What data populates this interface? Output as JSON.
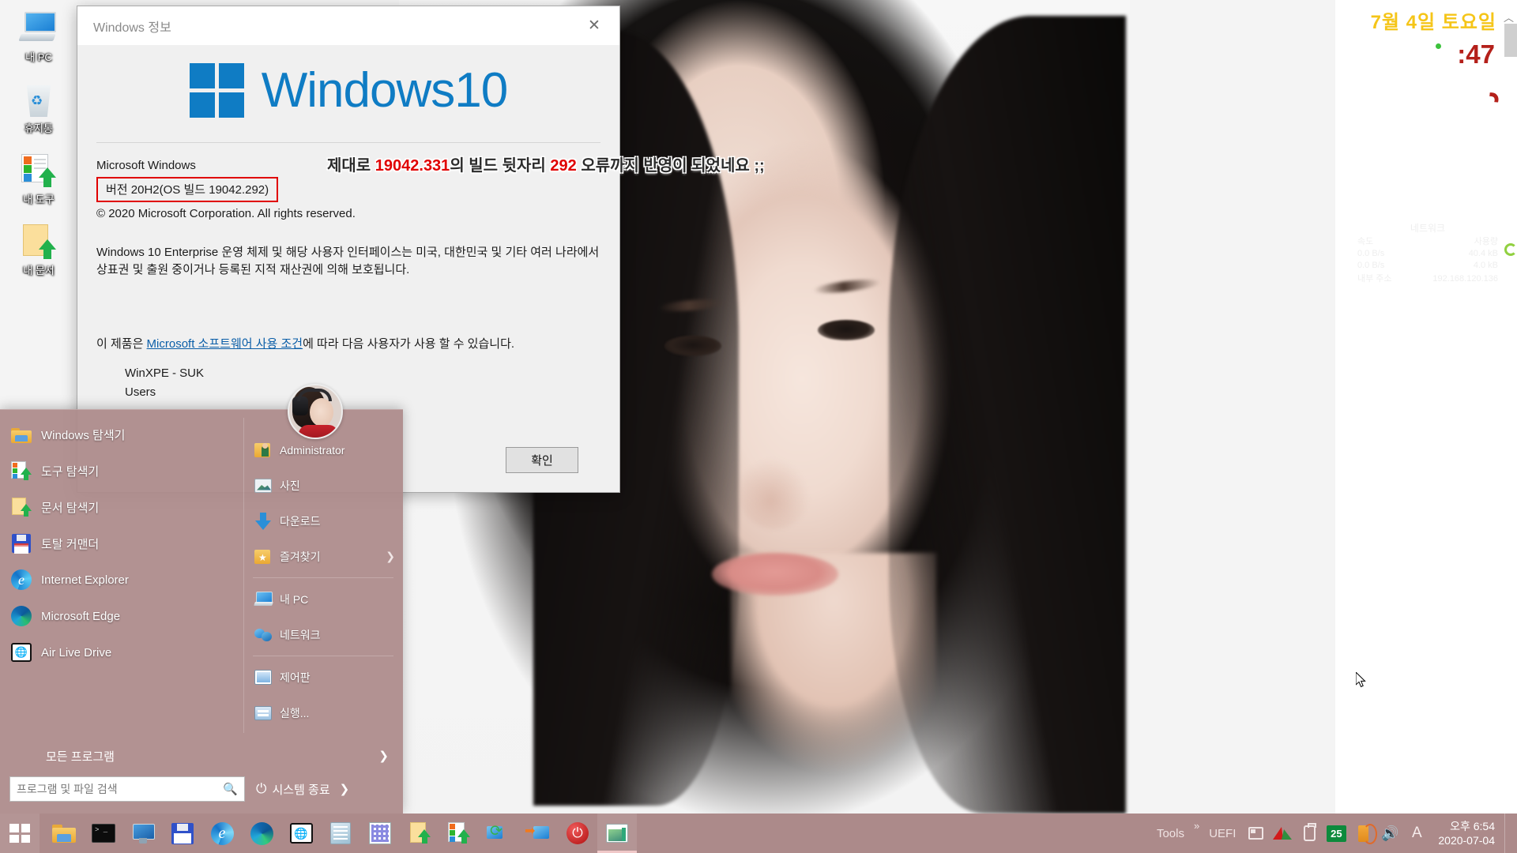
{
  "desktop": {
    "icons": [
      {
        "label": "내 PC",
        "icon": "my-computer-icon"
      },
      {
        "label": "휴지통",
        "icon": "recycle-bin-icon"
      },
      {
        "label": "내 도구",
        "icon": "my-tools-icon"
      },
      {
        "label": "내 문서",
        "icon": "my-documents-icon"
      }
    ]
  },
  "about_dialog": {
    "title": "Windows 정보",
    "close_label": "✕",
    "brand_windows": "Windows",
    "brand_ten": "10",
    "product_line": "Microsoft Windows",
    "version_line": "버전 20H2(OS 빌드 19042.292)",
    "copyright": "© 2020 Microsoft Corporation. All rights reserved.",
    "legal_paragraph": "Windows 10 Enterprise 운영 체제 및 해당 사용자 인터페이스는 미국, 대한민국 및 기타 여러 나라에서 상표권 및 출원 중이거나 등록된 지적 재산권에 의해 보호됩니다.",
    "license_prefix": "이 제품은 ",
    "license_link": "Microsoft 소프트웨어 사용 조건",
    "license_suffix": "에 따라 다음 사용자가 사용 할 수 있습니다.",
    "licensed_users": [
      "WinXPE - SUK",
      "Users"
    ],
    "ok_label": "확인"
  },
  "annotation": {
    "part1": "제대로 ",
    "build_a": "19042.331",
    "part2": "의 빌드 뒷자리 ",
    "build_b": "292",
    "part3": " 오류까지 반영이 되었네요 ;;",
    "color": "#e00000"
  },
  "start_menu": {
    "left_items": [
      {
        "label": "Windows 탐색기",
        "icon": "folder-icon"
      },
      {
        "label": "도구 탐색기",
        "icon": "tools-explorer-icon"
      },
      {
        "label": "문서 탐색기",
        "icon": "document-explorer-icon"
      },
      {
        "label": "토탈 커맨더",
        "icon": "total-commander-icon"
      },
      {
        "label": "Internet Explorer",
        "icon": "internet-explorer-icon"
      },
      {
        "label": "Microsoft Edge",
        "icon": "microsoft-edge-icon"
      },
      {
        "label": "Air Live Drive",
        "icon": "air-live-drive-icon"
      }
    ],
    "right_items": [
      {
        "label": "Administrator",
        "icon": "user-folder-icon",
        "chevron": ""
      },
      {
        "label": "사진",
        "icon": "pictures-icon",
        "chevron": ""
      },
      {
        "label": "다운로드",
        "icon": "downloads-icon",
        "chevron": ""
      },
      {
        "label": "즐겨찾기",
        "icon": "favorites-icon",
        "chevron": "❯"
      },
      {
        "label": "내 PC",
        "icon": "my-pc-icon",
        "chevron": ""
      },
      {
        "label": "네트워크",
        "icon": "network-icon",
        "chevron": ""
      },
      {
        "label": "제어판",
        "icon": "control-panel-icon",
        "chevron": ""
      },
      {
        "label": "실행...",
        "icon": "run-icon",
        "chevron": ""
      }
    ],
    "all_programs_label": "모든 프로그램",
    "all_programs_chevron": "❯",
    "search_placeholder": "프로그램 및 파일 검색",
    "search_value": "",
    "shutdown_label": "시스템 종료",
    "shutdown_chevron": "❯"
  },
  "taskbar": {
    "start_name": "start-button",
    "buttons": [
      {
        "name": "taskbar-file-explorer",
        "icon": "folder-icon"
      },
      {
        "name": "taskbar-command-prompt",
        "icon": "command-prompt-icon"
      },
      {
        "name": "taskbar-my-computer",
        "icon": "monitor-icon"
      },
      {
        "name": "taskbar-total-commander",
        "icon": "floppy-disk-icon"
      },
      {
        "name": "taskbar-internet-explorer",
        "icon": "internet-explorer-icon"
      },
      {
        "name": "taskbar-microsoft-edge",
        "icon": "microsoft-edge-icon"
      },
      {
        "name": "taskbar-air-live-drive",
        "icon": "air-live-drive-icon"
      },
      {
        "name": "taskbar-notepad",
        "icon": "notepad-icon"
      },
      {
        "name": "taskbar-pixel-tool",
        "icon": "grid-tool-icon"
      },
      {
        "name": "taskbar-document-explorer",
        "icon": "document-up-icon"
      },
      {
        "name": "taskbar-tools-explorer",
        "icon": "tools-up-icon"
      },
      {
        "name": "taskbar-backup-sync",
        "icon": "sync-icon"
      },
      {
        "name": "taskbar-transfer",
        "icon": "transfer-icon"
      },
      {
        "name": "taskbar-power",
        "icon": "power-icon"
      },
      {
        "name": "taskbar-window-manager",
        "icon": "window-icon"
      }
    ],
    "tray": {
      "tools_label": "Tools",
      "overflow_chevron": "»",
      "uefi_label": "UEFI",
      "battery_percent": "25",
      "ime_label": "A",
      "clock_time": "오후 6:54",
      "clock_date": "2020-07-04"
    }
  },
  "overlays": {
    "date_text": "7월 4일 토요일",
    "seconds_text": ":47",
    "network_widget": {
      "title": "네트워크",
      "col1": "속도",
      "col2": "사용량",
      "row1_speed": "0.0 B/s",
      "row1_usage": "40.4 kB",
      "row2_speed": "0.0 B/s",
      "row2_usage": "4.0 kB",
      "ip_label": "내부 주소",
      "ip_value": "192.168.120.136"
    }
  }
}
